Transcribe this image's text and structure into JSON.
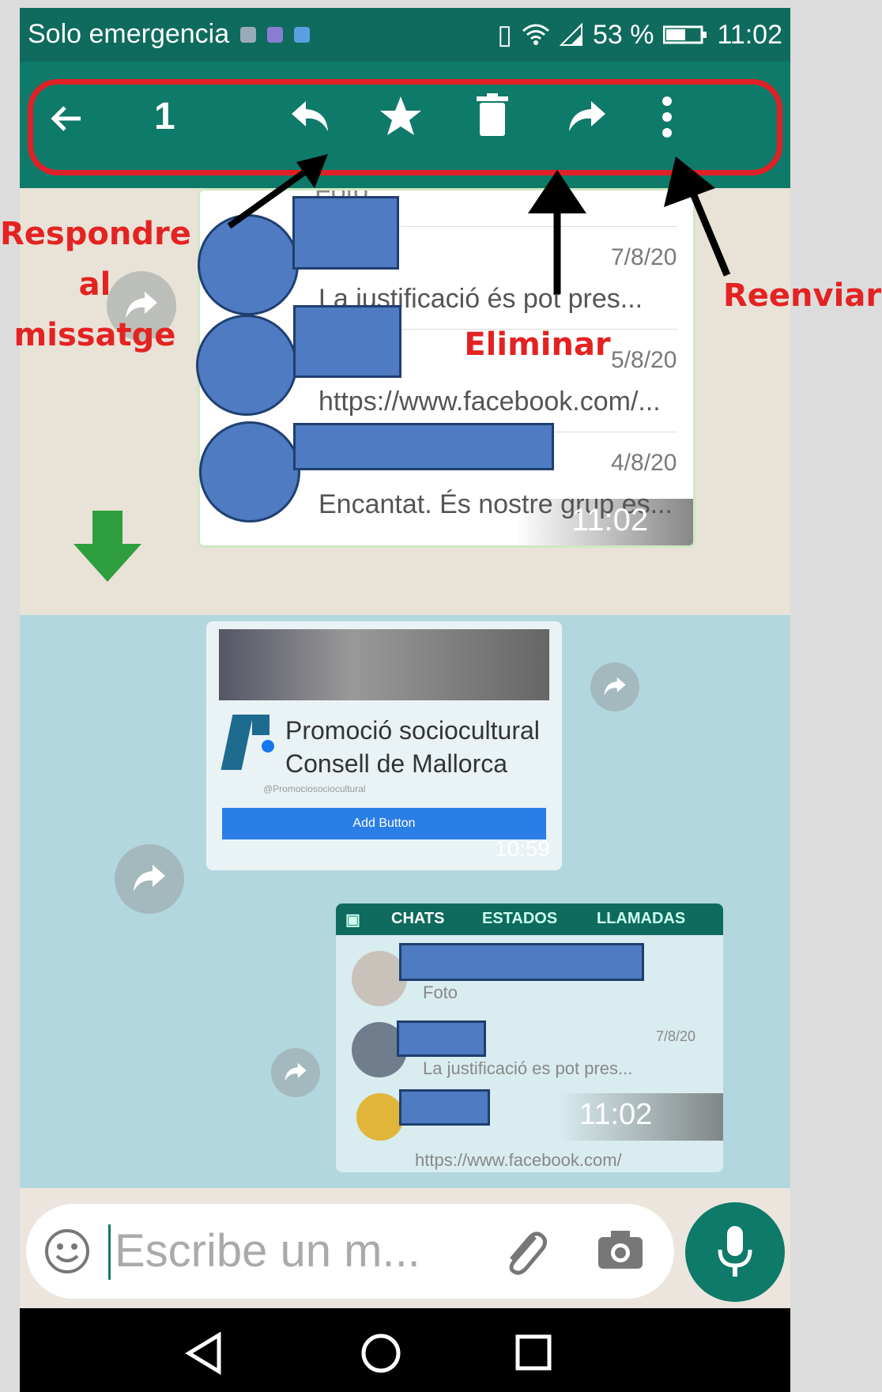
{
  "status_bar": {
    "carrier": "Solo emergencia",
    "battery": "53 %",
    "time": "11:02"
  },
  "action_bar": {
    "selected_count": "1"
  },
  "annotations": {
    "reply_line1": "Respondre",
    "reply_line2": "al",
    "reply_line3": "missatge",
    "delete": "Eliminar",
    "forward": "Reenviar"
  },
  "screenshot_message": {
    "top_partial": "Foto",
    "rows": [
      {
        "date": "7/8/20",
        "preview": "La justificació és pot pres..."
      },
      {
        "date": "5/8/20",
        "preview": "https://www.facebook.com/..."
      },
      {
        "date": "4/8/20",
        "preview": "Encantat. És nostre grup es..."
      }
    ],
    "time": "11:02"
  },
  "page_card": {
    "title_line1": "Promoció sociocultural",
    "title_line2": "Consell de Mallorca",
    "handle": "@Promociosociocultural",
    "button": "Add Button",
    "time": "10:59"
  },
  "second_screenshot": {
    "tabs": [
      "CHATS",
      "ESTADOS",
      "LLAMADAS"
    ],
    "row1_preview": "Foto",
    "row2_date": "7/8/20",
    "row2_preview": "La justificació es pot pres...",
    "row3_preview": "https://www.facebook.com/",
    "time": "11:02"
  },
  "composer": {
    "placeholder": "Escribe un m..."
  },
  "colors": {
    "header": "#0e7a69",
    "highlight": "#e02027",
    "redaction": "#4e7bc1"
  }
}
